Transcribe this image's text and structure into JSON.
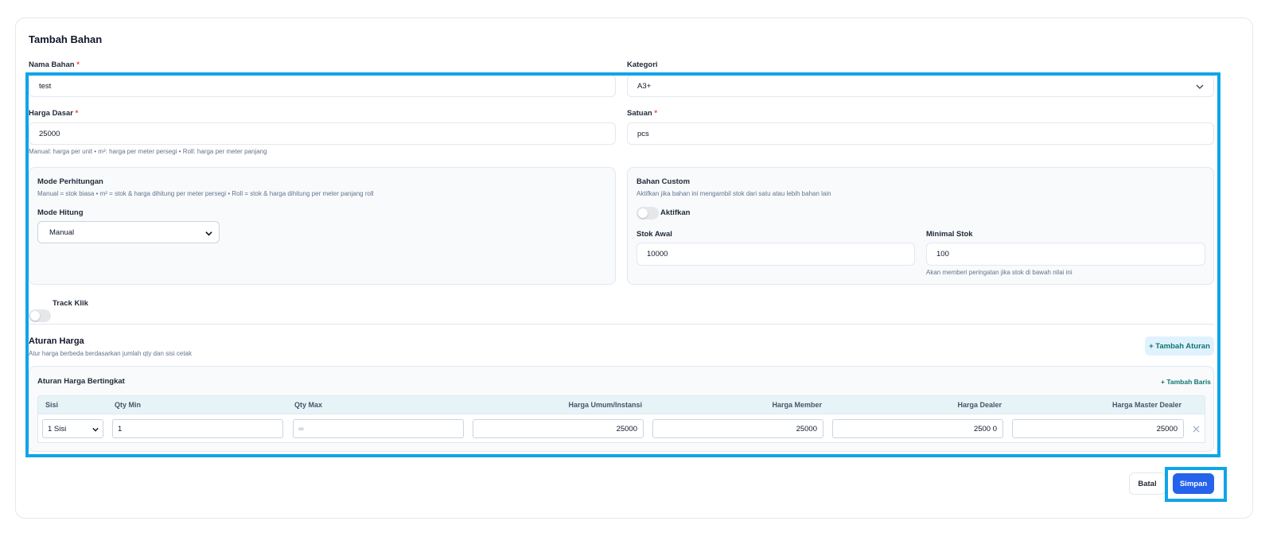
{
  "form": {
    "title": "Tambah Bahan",
    "nama_bahan": {
      "label": "Nama Bahan",
      "required_mark": "*",
      "value": "test"
    },
    "kategori": {
      "label": "Kategori",
      "value": "A3+"
    },
    "harga_dasar": {
      "label": "Harga Dasar",
      "required_mark": "*",
      "value": "25000",
      "hint": "Manual: harga per unit • m²: harga per meter persegi • Roll: harga per meter panjang"
    },
    "satuan": {
      "label": "Satuan",
      "required_mark": "*",
      "value": "pcs"
    }
  },
  "mode_perhitungan": {
    "title": "Mode Perhitungan",
    "desc": "Manual = stok biasa • m² = stok & harga dihitung per meter persegi • Roll = stok & harga dihitung per meter panjang roll",
    "mode_hitung_label": "Mode Hitung",
    "mode_hitung_value": "Manual"
  },
  "bahan_custom": {
    "title": "Bahan Custom",
    "desc": "Aktifkan jika bahan ini mengambil stok dari satu atau lebih bahan lain",
    "toggle_label": "Aktifkan",
    "toggle_on": false,
    "stok_awal_label": "Stok Awal",
    "stok_awal_value": "10000",
    "minimal_stok_label": "Minimal Stok",
    "minimal_stok_value": "100",
    "minimal_stok_hint": "Akan memberi peringatan jika stok di bawah nilai ini"
  },
  "track_klik": {
    "label": "Track Klik",
    "on": false
  },
  "aturan_harga": {
    "title": "Aturan Harga",
    "desc": "Atur harga berbeda berdasarkan jumlah qty dan sisi cetak",
    "add_button": "+ Tambah Aturan",
    "tier": {
      "title": "Aturan Harga Bertingkat",
      "add_row": "+ Tambah Baris",
      "columns": [
        "Sisi",
        "Qty Min",
        "Qty Max",
        "Harga Umum/Instansi",
        "Harga Member",
        "Harga Dealer",
        "Harga Master Dealer"
      ],
      "rows": [
        {
          "sisi": "1 Sisi",
          "qty_min": "1",
          "qty_max_placeholder": "∞",
          "harga_umum": "25000",
          "harga_member": "25000",
          "harga_dealer": "2500 0",
          "harga_master_dealer": "25000"
        }
      ]
    }
  },
  "actions": {
    "batal": "Batal",
    "simpan": "Simpan"
  },
  "icons": {
    "chevron": "chevron-down-icon",
    "close": "close-icon"
  }
}
